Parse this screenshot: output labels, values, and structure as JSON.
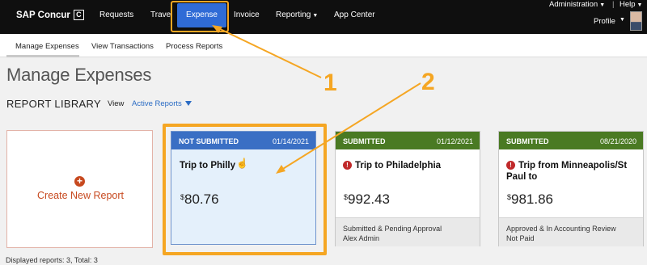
{
  "app": {
    "logo": "SAP Concur",
    "logo_mark": "C"
  },
  "nav": {
    "requests": "Requests",
    "travel": "Travel",
    "expense": "Expense",
    "invoice": "Invoice",
    "reporting": "Reporting",
    "app_center": "App Center"
  },
  "util": {
    "administration": "Administration",
    "help": "Help",
    "profile": "Profile"
  },
  "subnav": {
    "manage": "Manage Expenses",
    "view_transactions": "View Transactions",
    "process_reports": "Process Reports"
  },
  "page": {
    "title": "Manage Expenses",
    "library": "REPORT LIBRARY",
    "view_label": "View",
    "view_value": "Active Reports"
  },
  "create_card": {
    "label": "Create New Report",
    "icon": "plus-circle-icon"
  },
  "reports": [
    {
      "status": "NOT SUBMITTED",
      "date": "01/14/2021",
      "name": "Trip to Philly",
      "currency": "$",
      "amount": "80.76",
      "footer_line1": "",
      "footer_line2": "",
      "header_color": "#3a6fc4"
    },
    {
      "status": "SUBMITTED",
      "date": "01/12/2021",
      "name": "Trip to Philadelphia",
      "currency": "$",
      "amount": "992.43",
      "footer_line1": "Submitted & Pending Approval",
      "footer_line2": "Alex Admin",
      "header_color": "#4a7a23"
    },
    {
      "status": "SUBMITTED",
      "date": "08/21/2020",
      "name": "Trip from Minneapolis/St Paul to",
      "currency": "$",
      "amount": "981.86",
      "footer_line1": "Approved & In Accounting Review",
      "footer_line2": "Not Paid",
      "header_color": "#4a7a23"
    }
  ],
  "footer": {
    "displayed": "Displayed reports: 3, Total: 3"
  },
  "annotations": {
    "one": "1",
    "two": "2",
    "color": "#f5a623"
  },
  "colors": {
    "accent": "#2f6bd6",
    "create": "#c7491f",
    "alert": "#c0292a"
  }
}
